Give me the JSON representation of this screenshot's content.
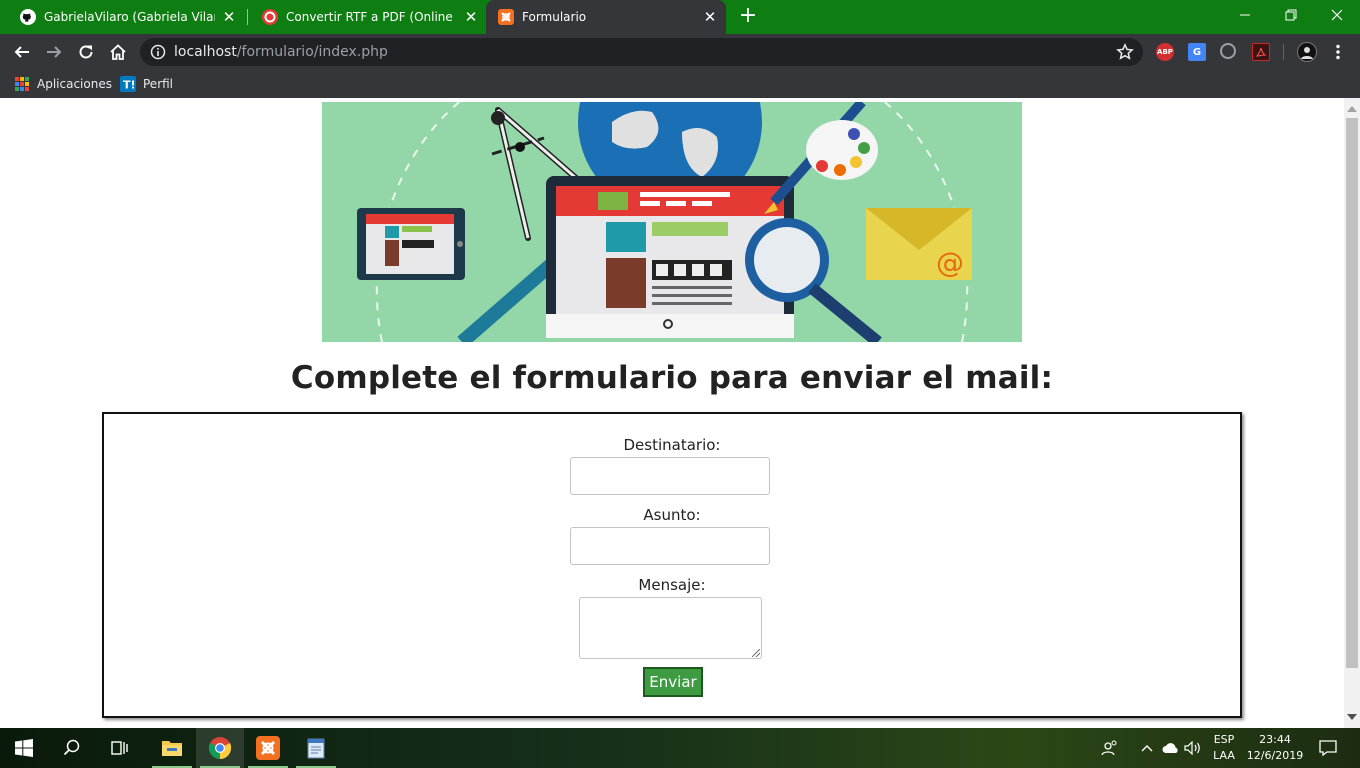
{
  "browser": {
    "tabs": [
      {
        "title": "GabrielaVilaro (Gabriela Vilaró)",
        "favicon": "github-icon",
        "active": false
      },
      {
        "title": "Convertir RTF a PDF (Online y Gra",
        "favicon": "converter-icon",
        "active": false
      },
      {
        "title": "Formulario",
        "favicon": "xampp-icon",
        "active": true
      }
    ],
    "url_host": "localhost",
    "url_path": "/formulario/index.php",
    "bookmarks": [
      {
        "label": "Aplicaciones",
        "icon": "apps-grid-icon"
      },
      {
        "label": "Perfil",
        "icon": "trello-icon"
      }
    ],
    "extensions": [
      "adblock-plus-icon",
      "google-translate-icon",
      "extension-icon",
      "pdf-icon",
      "profile-avatar"
    ]
  },
  "page": {
    "heading": "Complete el formulario para enviar el mail:",
    "form": {
      "to_label": "Destinatario:",
      "to_value": "",
      "subject_label": "Asunto:",
      "subject_value": "",
      "message_label": "Mensaje:",
      "message_value": "",
      "submit_label": "Enviar"
    }
  },
  "taskbar": {
    "apps": [
      "start-icon",
      "search-icon",
      "task-view-icon",
      "file-explorer-icon",
      "chrome-icon",
      "xampp-icon",
      "notepad-icon"
    ],
    "language": "ESP",
    "keyboard": "LAA",
    "time": "23:44",
    "date": "12/6/2019"
  },
  "colors": {
    "tabstrip": "#0f7e12",
    "toolbar": "#35363a",
    "banner_bg": "#93d7a9",
    "button": "#3e9b42"
  }
}
